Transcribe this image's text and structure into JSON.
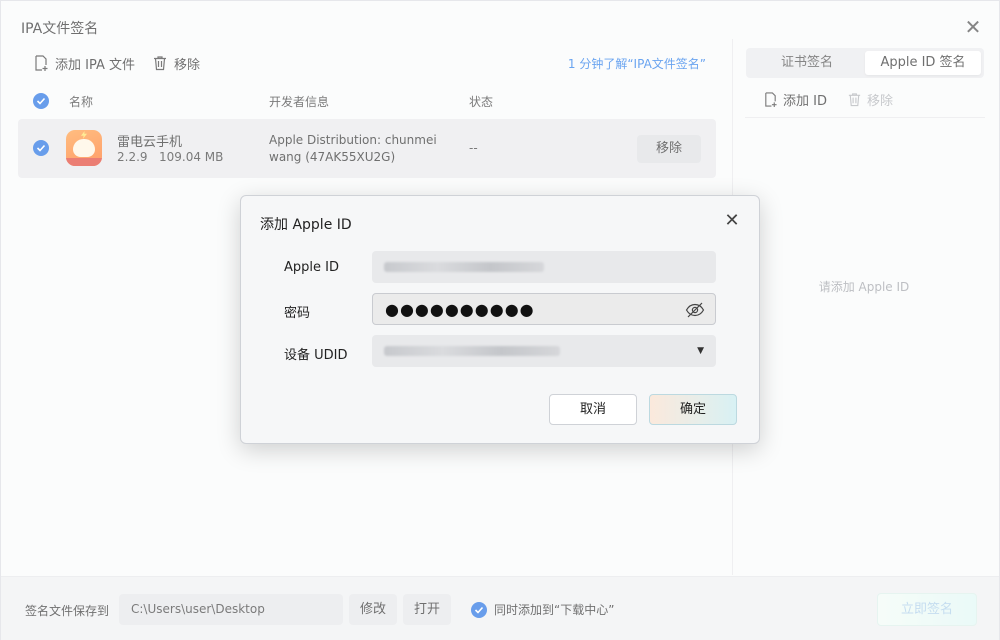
{
  "window": {
    "title": "IPA文件签名"
  },
  "toolbar": {
    "add_label": "添加 IPA 文件",
    "remove_label": "移除",
    "help_link": "1 分钟了解“IPA文件签名”"
  },
  "table": {
    "headers": {
      "name": "名称",
      "developer": "开发者信息",
      "status": "状态"
    },
    "rows": [
      {
        "app_name": "雷电云手机",
        "meta": "2.2.9   109.04 MB",
        "developer": "Apple Distribution: chunmei wang (47AK55XU2G)",
        "status": "--",
        "remove_label": "移除"
      }
    ]
  },
  "right_panel": {
    "tabs": [
      {
        "label": "证书签名"
      },
      {
        "label": "Apple ID 签名"
      }
    ],
    "add_label": "添加 ID",
    "remove_label": "移除",
    "empty_hint": "请添加 Apple ID"
  },
  "footer": {
    "save_label": "签名文件保存到",
    "path": "C:\\Users\\user\\Desktop",
    "modify_label": "修改",
    "open_label": "打开",
    "checkbox_label": "同时添加到“下载中心”",
    "sign_label": "立即签名"
  },
  "dialog": {
    "title": "添加 Apple ID",
    "apple_id_label": "Apple ID",
    "password_label": "密码",
    "password_value": "●●●●●●●●●●",
    "udid_label": "设备 UDID",
    "cancel_label": "取消",
    "ok_label": "确定"
  },
  "colors": {
    "accent": "#1769e0",
    "link": "#1a73e8"
  }
}
